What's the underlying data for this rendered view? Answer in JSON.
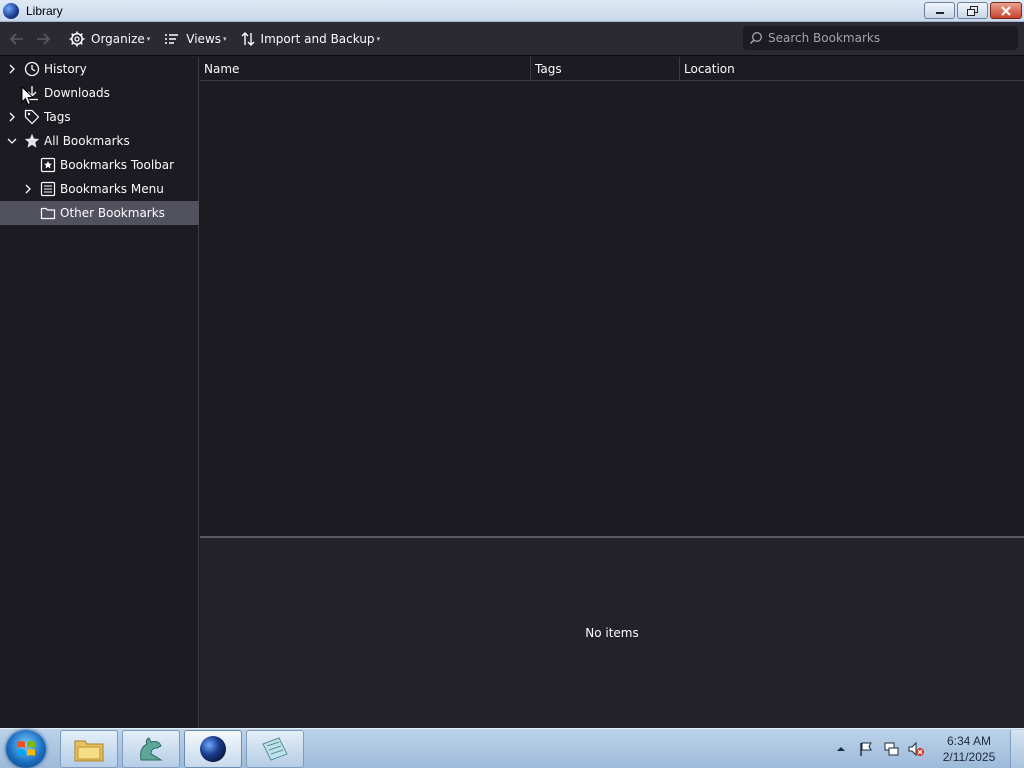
{
  "window": {
    "title": "Library"
  },
  "toolbar": {
    "organize_label": "Organize",
    "views_label": "Views",
    "import_label": "Import and Backup",
    "search_placeholder": "Search Bookmarks"
  },
  "sidebar": {
    "items": [
      {
        "label": "History",
        "icon": "clock-icon",
        "expandable": true,
        "expanded": false
      },
      {
        "label": "Downloads",
        "icon": "download-icon",
        "expandable": false
      },
      {
        "label": "Tags",
        "icon": "tag-icon",
        "expandable": true,
        "expanded": false
      },
      {
        "label": "All Bookmarks",
        "icon": "star-icon",
        "expandable": true,
        "expanded": true
      },
      {
        "label": "Bookmarks Toolbar",
        "icon": "bookmarks-toolbar-icon",
        "expandable": false
      },
      {
        "label": "Bookmarks Menu",
        "icon": "bookmarks-menu-icon",
        "expandable": true,
        "expanded": false
      },
      {
        "label": "Other Bookmarks",
        "icon": "folder-icon",
        "expandable": false,
        "selected": true
      }
    ]
  },
  "columns": {
    "name": "Name",
    "tags": "Tags",
    "location": "Location"
  },
  "details": {
    "empty_text": "No items"
  },
  "taskbar": {
    "items": [
      "file-explorer-icon",
      "dragon-app-icon",
      "browser-globe-icon",
      "notepad-icon"
    ],
    "active_item": "browser-globe-icon",
    "clock_time": "6:34 AM",
    "clock_date": "2/11/2025"
  },
  "colors": {
    "background": "#1c1b22",
    "toolbar": "#2b2a33",
    "selected_row": "#52525e",
    "text": "#fbfbfe"
  }
}
